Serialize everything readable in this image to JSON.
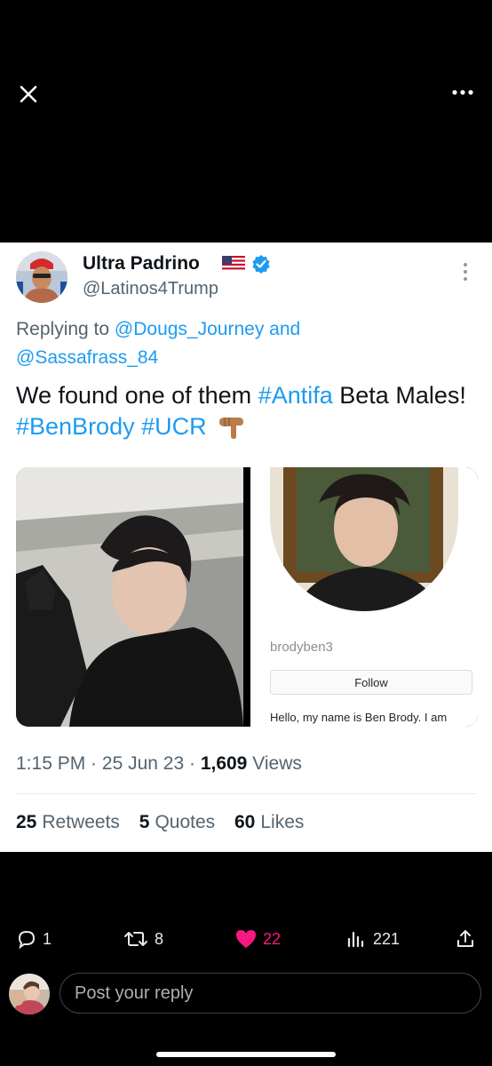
{
  "tweet": {
    "display_name": "Ultra Padrino",
    "handle": "@Latinos4Trump",
    "replying_prefix": "Replying to",
    "replying_to_1": "@Dougs_Journey",
    "replying_and": "and",
    "replying_to_2": "@Sassafrass_84",
    "text_1": "We found one of them",
    "hashtag_1": "#Antifa",
    "text_2": "Beta Males!",
    "hashtag_2": "#BenBrody",
    "hashtag_3": "#UCR",
    "time": "1:15 PM",
    "date": "25 Jun 23",
    "views_count": "1,609",
    "views_label": "Views",
    "retweets_count": "25",
    "retweets_label": "Retweets",
    "quotes_count": "5",
    "quotes_label": "Quotes",
    "likes_count": "60",
    "likes_label": "Likes"
  },
  "media": {
    "screenshot_username": "brodyben3",
    "screenshot_follow": "Follow",
    "screenshot_bio": "Hello, my name is Ben Brody. I am"
  },
  "actions": {
    "reply_count": "1",
    "retweet_count": "8",
    "like_count": "22",
    "views_count": "221"
  },
  "composer": {
    "placeholder": "Post your reply"
  },
  "colors": {
    "link": "#1d9bf0",
    "like_active": "#f91880",
    "secondary_text": "#536471"
  },
  "icons": [
    "close-icon",
    "more-icon",
    "verified-icon",
    "us-flag-icon",
    "kebab-icon",
    "reply-icon",
    "retweet-icon",
    "heart-icon",
    "analytics-icon",
    "share-icon",
    "pointing-down-icon"
  ]
}
